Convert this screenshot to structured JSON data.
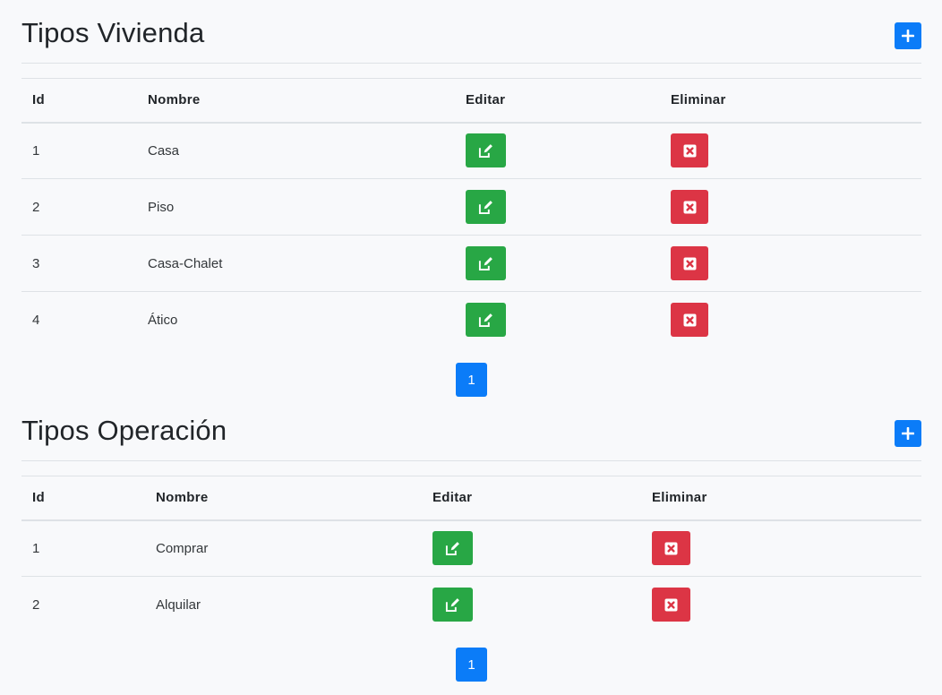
{
  "colors": {
    "primary": "#0b7cf8",
    "success": "#28a745",
    "danger": "#dc3545",
    "background": "#f8f9fb"
  },
  "vivienda": {
    "title": "Tipos Vivienda",
    "add_icon": "plus-icon",
    "headers": {
      "id": "Id",
      "nombre": "Nombre",
      "editar": "Editar",
      "eliminar": "Eliminar"
    },
    "rows": [
      {
        "id": "1",
        "nombre": "Casa"
      },
      {
        "id": "2",
        "nombre": "Piso"
      },
      {
        "id": "3",
        "nombre": "Casa-Chalet"
      },
      {
        "id": "4",
        "nombre": "Ático"
      }
    ],
    "pagination": {
      "current_page": "1"
    }
  },
  "operacion": {
    "title": "Tipos Operación",
    "add_icon": "plus-icon",
    "headers": {
      "id": "Id",
      "nombre": "Nombre",
      "editar": "Editar",
      "eliminar": "Eliminar"
    },
    "rows": [
      {
        "id": "1",
        "nombre": "Comprar"
      },
      {
        "id": "2",
        "nombre": "Alquilar"
      }
    ],
    "pagination": {
      "current_page": "1"
    }
  },
  "icons": {
    "edit": "edit-icon",
    "delete": "close-square-icon"
  }
}
